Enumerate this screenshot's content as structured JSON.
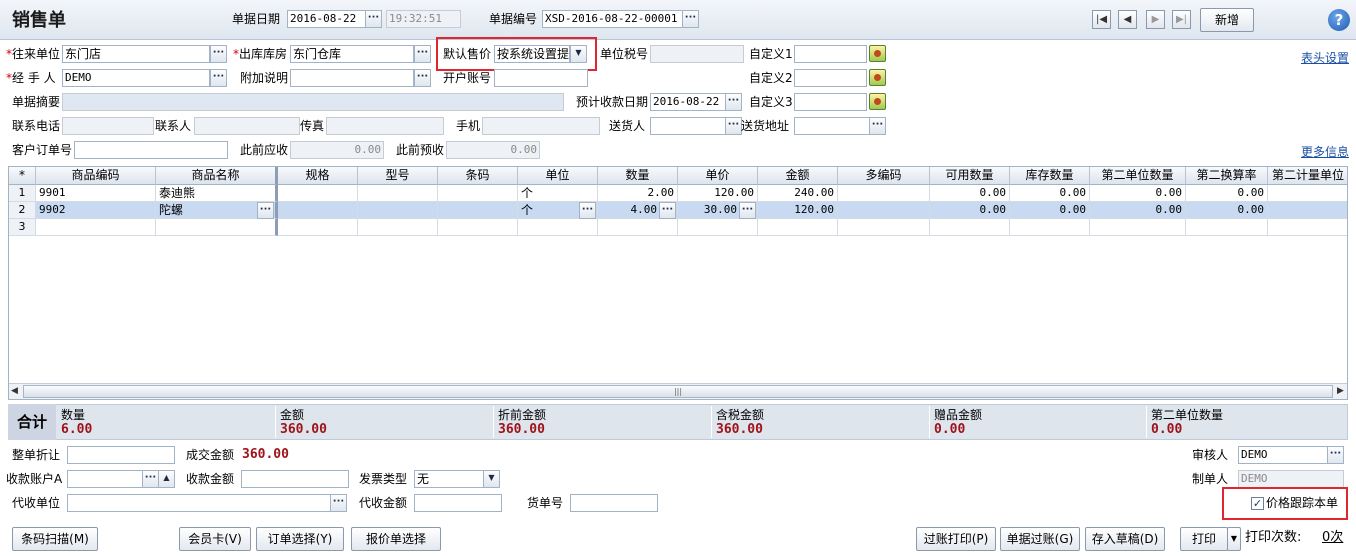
{
  "header": {
    "title": "销售单",
    "date_label": "单据日期",
    "date_value": "2016-08-22",
    "time_value": "19:32:51",
    "docno_label": "单据编号",
    "docno_value": "XSD-2016-08-22-00001",
    "new_button": "新增",
    "help": "?"
  },
  "form": {
    "partner_label": "往来单位",
    "partner_value": "东门店",
    "warehouse_label": "出库库房",
    "warehouse_value": "东门仓库",
    "price_label": "默认售价",
    "price_value": "按系统设置提",
    "taxno_label": "单位税号",
    "custom1_label": "自定义1",
    "header_settings": "表头设置",
    "handler_label": "经 手 人",
    "handler_value": "DEMO",
    "note_label": "附加说明",
    "account_label": "开户账号",
    "custom2_label": "自定义2",
    "summary_label": "单据摘要",
    "due_label": "预计收款日期",
    "due_value": "2016-08-22",
    "custom3_label": "自定义3",
    "phone_label": "联系电话",
    "contact_label": "联系人",
    "fax_label": "传真",
    "mobile_label": "手机",
    "deliver_label": "送货人",
    "address_label": "送货地址",
    "order_label": "客户订单号",
    "prev_recv_label": "此前应收",
    "prev_recv_value": "0.00",
    "prev_pre_label": "此前预收",
    "prev_pre_value": "0.00",
    "more_info": "更多信息"
  },
  "grid": {
    "columns": [
      "*",
      "商品编码",
      "商品名称",
      "规格",
      "型号",
      "条码",
      "单位",
      "数量",
      "单价",
      "金额",
      "多编码",
      "可用数量",
      "库存数量",
      "第二单位数量",
      "第二换算率",
      "第二计量单位"
    ],
    "rows": [
      {
        "no": "1",
        "code": "9901",
        "name": "泰迪熊",
        "unit": "个",
        "qty": "2.00",
        "price": "120.00",
        "amount": "240.00",
        "avail": "0.00",
        "stock": "0.00",
        "qty2": "0.00",
        "rate2": "0.00"
      },
      {
        "no": "2",
        "code": "9902",
        "name": "陀螺",
        "unit": "个",
        "qty": "4.00",
        "price": "30.00",
        "amount": "120.00",
        "avail": "0.00",
        "stock": "0.00",
        "qty2": "0.00",
        "rate2": "0.00"
      },
      {
        "no": "3",
        "code": "",
        "name": "",
        "unit": "",
        "qty": "",
        "price": "",
        "amount": "",
        "avail": "",
        "stock": "",
        "qty2": "",
        "rate2": ""
      }
    ],
    "scroll_mark": "|||"
  },
  "totals": {
    "label": "合计",
    "items": [
      {
        "label": "数量",
        "value": "6.00"
      },
      {
        "label": "金额",
        "value": "360.00"
      },
      {
        "label": "折前金额",
        "value": "360.00"
      },
      {
        "label": "含税金额",
        "value": "360.00"
      },
      {
        "label": "赠品金额",
        "value": "0.00"
      },
      {
        "label": "第二单位数量",
        "value": "0.00"
      }
    ]
  },
  "footer": {
    "discount_label": "整单折让",
    "deal_label": "成交金额",
    "deal_value": "360.00",
    "auditor_label": "审核人",
    "auditor_value": "DEMO",
    "recv_account_label": "收款账户A",
    "recv_amount_label": "收款金额",
    "invoice_label": "发票类型",
    "invoice_value": "无",
    "maker_label": "制单人",
    "maker_value": "DEMO",
    "agent_label": "代收单位",
    "agent_amount_label": "代收金额",
    "waybill_label": "货单号",
    "track_price_label": "价格跟踪本单",
    "track_price_checked": true
  },
  "buttons": {
    "barcode": "条码扫描(M)",
    "member": "会员卡(V)",
    "order_select": "订单选择(Y)",
    "quote_select": "报价单选择",
    "post_print": "过账打印(P)",
    "post": "单据过账(G)",
    "draft": "存入草稿(D)",
    "print": "打印",
    "print_count_label": "打印次数:",
    "print_count_value": "0次"
  }
}
